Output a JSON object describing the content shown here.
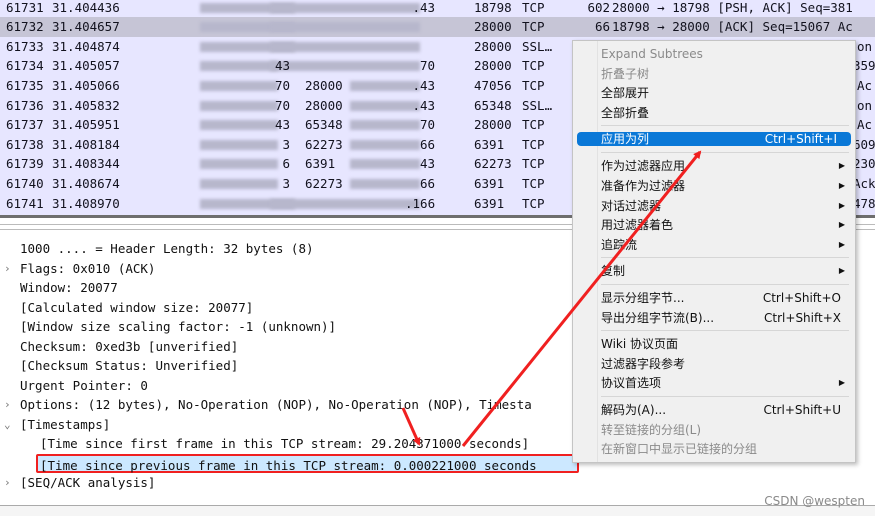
{
  "packets": [
    {
      "no": "61731",
      "time": "31.404436",
      "src_tail": "",
      "srcport": "",
      "dst_tail": ".43",
      "dstport": "18798",
      "proto": "TCP",
      "len": "602",
      "info": "28000 → 18798 [PSH, ACK] Seq=381"
    },
    {
      "no": "61732",
      "time": "31.404657",
      "src_tail": "",
      "srcport": "",
      "dst_tail": "",
      "dstport": "28000",
      "proto": "TCP",
      "len": "66",
      "info": "18798 → 28000 [ACK] Seq=15067 Ac",
      "selected": true
    },
    {
      "no": "61733",
      "time": "31.404874",
      "src_tail": "",
      "srcport": "",
      "dst_tail": "",
      "dstport": "28000",
      "proto": "SSL…",
      "len": "",
      "info": "on"
    },
    {
      "no": "61734",
      "time": "31.405057",
      "src_tail": "43",
      "srcport": "",
      "dst_tail": "70",
      "dstport": "28000",
      "proto": "TCP",
      "len": "",
      "info": "359"
    },
    {
      "no": "61735",
      "time": "31.405066",
      "src_tail": "70",
      "srcport": "28000",
      "dst_tail": ".43",
      "dstport": "47056",
      "proto": "TCP",
      "len": "",
      "info": "Ac"
    },
    {
      "no": "61736",
      "time": "31.405832",
      "src_tail": "70",
      "srcport": "28000",
      "dst_tail": ".43",
      "dstport": "65348",
      "proto": "SSL…",
      "len": "",
      "info": "on"
    },
    {
      "no": "61737",
      "time": "31.405951",
      "src_tail": "43",
      "srcport": "65348",
      "dst_tail": "70",
      "dstport": "28000",
      "proto": "TCP",
      "len": "",
      "info": "Ac"
    },
    {
      "no": "61738",
      "time": "31.408184",
      "src_tail": "3",
      "srcport": "62273",
      "dst_tail": "66",
      "dstport": "6391",
      "proto": "TCP",
      "len": "",
      "info": "609"
    },
    {
      "no": "61739",
      "time": "31.408344",
      "src_tail": "6",
      "srcport": "6391",
      "dst_tail": "43",
      "dstport": "62273",
      "proto": "TCP",
      "len": "",
      "info": "230"
    },
    {
      "no": "61740",
      "time": "31.408674",
      "src_tail": "3",
      "srcport": "62273",
      "dst_tail": "66",
      "dstport": "6391",
      "proto": "TCP",
      "len": "",
      "info": "Ack"
    },
    {
      "no": "61741",
      "time": "31.408970",
      "src_tail": "",
      "srcport": "",
      "dst_tail": ".166",
      "dstport": "6391",
      "proto": "TCP",
      "len": "",
      "info": "478"
    }
  ],
  "details": [
    {
      "text": "1000 .... = Header Length: 32 bytes (8)",
      "indent": 1,
      "expander": ""
    },
    {
      "text": "Flags: 0x010 (ACK)",
      "indent": 1,
      "expander": ">"
    },
    {
      "text": "Window: 20077",
      "indent": 1,
      "expander": ""
    },
    {
      "text": "[Calculated window size: 20077]",
      "indent": 1,
      "expander": ""
    },
    {
      "text": "[Window size scaling factor: -1 (unknown)]",
      "indent": 1,
      "expander": ""
    },
    {
      "text": "Checksum: 0xed3b [unverified]",
      "indent": 1,
      "expander": ""
    },
    {
      "text": "[Checksum Status: Unverified]",
      "indent": 1,
      "expander": ""
    },
    {
      "text": "Urgent Pointer: 0",
      "indent": 1,
      "expander": ""
    },
    {
      "text": "Options: (12 bytes), No-Operation (NOP), No-Operation (NOP), Timesta",
      "indent": 1,
      "expander": ">"
    },
    {
      "text": "[Timestamps]",
      "indent": 1,
      "expander": "⌄"
    },
    {
      "text": "[Time since first frame in this TCP stream: 29.204371000 seconds]",
      "indent": 2,
      "expander": ""
    },
    {
      "text": "[Time since previous frame in this TCP stream: 0.000221000 seconds",
      "indent": 2,
      "expander": "",
      "highlighted": true
    },
    {
      "text": "[SEQ/ACK analysis]",
      "indent": 1,
      "expander": ">"
    }
  ],
  "context_menu": {
    "items": [
      {
        "label": "Expand Subtrees",
        "disabled": true
      },
      {
        "label": "折叠子树",
        "disabled": true
      },
      {
        "label": "全部展开"
      },
      {
        "label": "全部折叠"
      },
      {
        "sep": true
      },
      {
        "label": "应用为列",
        "shortcut": "Ctrl+Shift+I",
        "active": true
      },
      {
        "sep": true
      },
      {
        "label": "作为过滤器应用",
        "submenu": true
      },
      {
        "label": "准备作为过滤器",
        "submenu": true
      },
      {
        "label": "对话过滤器",
        "submenu": true
      },
      {
        "label": "用过滤器着色",
        "submenu": true
      },
      {
        "label": "追踪流",
        "submenu": true
      },
      {
        "sep": true
      },
      {
        "label": "复制",
        "submenu": true
      },
      {
        "sep": true
      },
      {
        "label": "显示分组字节...",
        "shortcut": "Ctrl+Shift+O"
      },
      {
        "label": "导出分组字节流(B)...",
        "shortcut": "Ctrl+Shift+X"
      },
      {
        "sep": true
      },
      {
        "label": "Wiki 协议页面"
      },
      {
        "label": "过滤器字段参考"
      },
      {
        "label": "协议首选项",
        "submenu": true
      },
      {
        "sep": true
      },
      {
        "label": "解码为(A)...",
        "shortcut": "Ctrl+Shift+U"
      },
      {
        "label": "转至链接的分组(L)",
        "disabled": true
      },
      {
        "label": "在新窗口中显示已链接的分组",
        "disabled": true
      }
    ]
  },
  "watermark": "CSDN @wespten",
  "colors": {
    "packet_bg": "#e7e6ff",
    "selected_row": "#c6c5d6",
    "menu_active": "#0a78d7",
    "annotation": "#f02020",
    "field_highlight": "#cce8ff"
  },
  "icons": {
    "submenu": "triangle-right-icon",
    "expander": "chevron-icon"
  }
}
